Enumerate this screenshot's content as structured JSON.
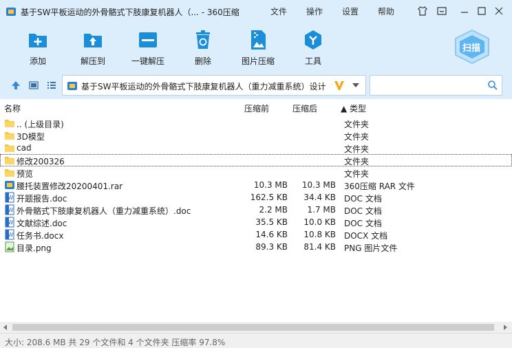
{
  "window": {
    "title": "基于SW平板运动的外骨骼式下肢康复机器人（... - 360压缩",
    "menus": [
      "文件",
      "操作",
      "设置",
      "帮助"
    ]
  },
  "toolbar": {
    "items": [
      {
        "label": "添加",
        "icon": "add-file-icon"
      },
      {
        "label": "解压到",
        "icon": "extract-to-icon"
      },
      {
        "label": "一键解压",
        "icon": "one-click-extract-icon"
      },
      {
        "label": "删除",
        "icon": "delete-icon"
      },
      {
        "label": "图片压缩",
        "icon": "image-compress-icon"
      },
      {
        "label": "工具",
        "icon": "tools-icon"
      }
    ],
    "scan_label": "扫描"
  },
  "address": {
    "path": "基于SW平板运动的外骨骼式下肢康复机器人（重力减重系统）设计（"
  },
  "columns": {
    "name": "名称",
    "size": "压缩前",
    "packed": "压缩后",
    "type": "▲ 类型"
  },
  "files": [
    {
      "name": ".. (上级目录)",
      "size": "",
      "packed": "",
      "type": "文件夹",
      "icon": "folder-icon"
    },
    {
      "name": "3D模型",
      "size": "",
      "packed": "",
      "type": "文件夹",
      "icon": "folder-icon"
    },
    {
      "name": "cad",
      "size": "",
      "packed": "",
      "type": "文件夹",
      "icon": "folder-icon"
    },
    {
      "name": "修改200326",
      "size": "",
      "packed": "",
      "type": "文件夹",
      "icon": "folder-icon",
      "selected": true
    },
    {
      "name": "预览",
      "size": "",
      "packed": "",
      "type": "文件夹",
      "icon": "folder-icon"
    },
    {
      "name": "腰托装置修改20200401.rar",
      "size": "10.3 MB",
      "packed": "10.3 MB",
      "type": "360压缩 RAR 文件",
      "icon": "rar-archive-icon"
    },
    {
      "name": "开题报告.doc",
      "size": "162.5 KB",
      "packed": "34.4 KB",
      "type": "DOC 文档",
      "icon": "word-doc-icon"
    },
    {
      "name": "外骨骼式下肢康复机器人（重力减重系统）.doc",
      "size": "2.2 MB",
      "packed": "1.7 MB",
      "type": "DOC 文档",
      "icon": "word-doc-icon"
    },
    {
      "name": "文献综述.doc",
      "size": "35.5 KB",
      "packed": "10.0 KB",
      "type": "DOC 文档",
      "icon": "word-doc-icon"
    },
    {
      "name": "任务书.docx",
      "size": "14.6 KB",
      "packed": "10.8 KB",
      "type": "DOCX 文档",
      "icon": "word-doc-icon"
    },
    {
      "name": "目录.png",
      "size": "89.3 KB",
      "packed": "81.4 KB",
      "type": "PNG 图片文件",
      "icon": "png-image-icon"
    }
  ],
  "status": {
    "text": "大小: 208.6 MB 共 29 个文件和 4 个文件夹 压缩率 97.8%"
  },
  "colors": {
    "chrome": "#dceefb",
    "accent": "#1a8fd8",
    "folder": "#f5c845"
  }
}
